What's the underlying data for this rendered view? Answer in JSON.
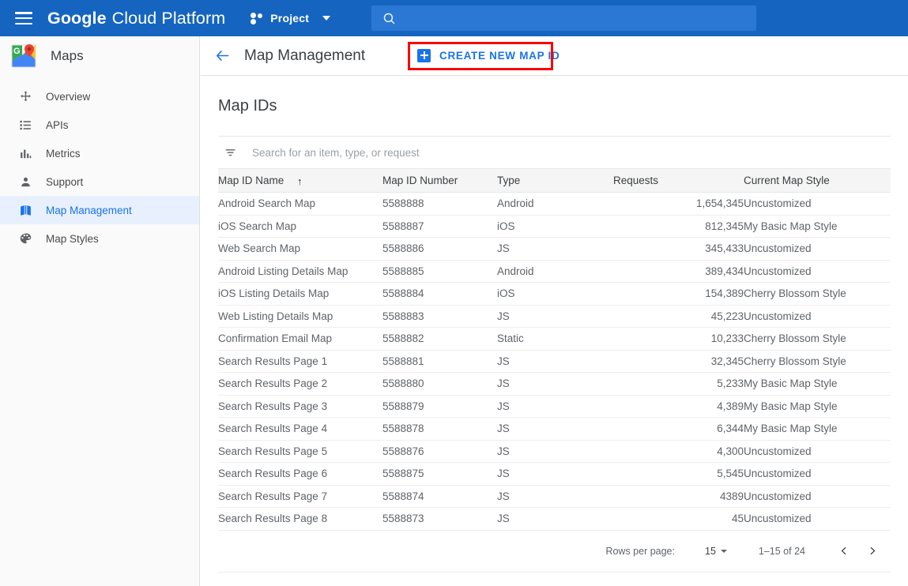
{
  "topbar": {
    "menu_icon": "hamburger-icon",
    "brand_bold": "Google",
    "brand_light": "Cloud Platform",
    "project_label": "Project",
    "project_icon": "project-dots-icon",
    "dropdown_icon": "chevron-down-icon",
    "search": {
      "value": "",
      "placeholder": "",
      "icon": "search-icon"
    },
    "bg_color": "#1565c0"
  },
  "sidebar": {
    "product_icon": "google-maps-logo-icon",
    "product_title": "Maps",
    "active_bg_color": "#e8f0fe",
    "active_text_color": "#1a73e8",
    "items": [
      {
        "label": "Overview",
        "icon": "overview-move-icon",
        "active": false
      },
      {
        "label": "APIs",
        "icon": "list-icon",
        "active": false
      },
      {
        "label": "Metrics",
        "icon": "bar-chart-icon",
        "active": false
      },
      {
        "label": "Support",
        "icon": "person-icon",
        "active": false
      },
      {
        "label": "Map Management",
        "icon": "map-icon",
        "active": true
      },
      {
        "label": "Map Styles",
        "icon": "palette-icon",
        "active": false
      }
    ]
  },
  "content": {
    "back_icon": "back-arrow-icon",
    "page_title": "Map Management",
    "create_button": {
      "label": "CREATE NEW MAP ID",
      "icon": "plus-square-icon",
      "color": "#1a73e8",
      "highlight_color": "#fb0007"
    },
    "section_title": "Map IDs",
    "filter": {
      "icon": "filter-icon",
      "value": "",
      "placeholder": "Search for an item, type, or request"
    },
    "table": {
      "columns": [
        {
          "label": "Map ID Name",
          "sort": "ascending",
          "sort_icon": "arrow-up-icon"
        },
        {
          "label": "Map ID Number"
        },
        {
          "label": "Type"
        },
        {
          "label": "Requests"
        },
        {
          "label": "Current Map Style"
        }
      ],
      "rows": [
        {
          "name": "Android Search Map",
          "number": "5588888",
          "type": "Android",
          "requests": "1,654,345",
          "style": "Uncustomized"
        },
        {
          "name": "iOS Search Map",
          "number": "5588887",
          "type": "iOS",
          "requests": "812,345",
          "style": "My Basic Map Style"
        },
        {
          "name": "Web Search Map",
          "number": "5588886",
          "type": "JS",
          "requests": "345,433",
          "style": "Uncustomized"
        },
        {
          "name": "Android Listing Details Map",
          "number": "5588885",
          "type": "Android",
          "requests": "389,434",
          "style": "Uncustomized"
        },
        {
          "name": "iOS Listing Details Map",
          "number": "5588884",
          "type": "iOS",
          "requests": "154,389",
          "style": "Cherry Blossom Style"
        },
        {
          "name": "Web Listing Details Map",
          "number": "5588883",
          "type": "JS",
          "requests": "45,223",
          "style": "Uncustomized"
        },
        {
          "name": "Confirmation Email Map",
          "number": "5588882",
          "type": "Static",
          "requests": "10,233",
          "style": "Cherry Blossom Style"
        },
        {
          "name": "Search Results Page 1",
          "number": "5588881",
          "type": "JS",
          "requests": "32,345",
          "style": "Cherry Blossom Style"
        },
        {
          "name": "Search Results Page 2",
          "number": "5588880",
          "type": "JS",
          "requests": "5,233",
          "style": "My Basic Map Style"
        },
        {
          "name": "Search Results Page 3",
          "number": "5588879",
          "type": "JS",
          "requests": "4,389",
          "style": "My Basic Map Style"
        },
        {
          "name": "Search Results Page 4",
          "number": "5588878",
          "type": "JS",
          "requests": "6,344",
          "style": "My Basic Map Style"
        },
        {
          "name": "Search Results Page 5",
          "number": "5588876",
          "type": "JS",
          "requests": "4,300",
          "style": "Uncustomized"
        },
        {
          "name": "Search Results Page 6",
          "number": "5588875",
          "type": "JS",
          "requests": "5,545",
          "style": "Uncustomized"
        },
        {
          "name": "Search Results Page 7",
          "number": "5588874",
          "type": "JS",
          "requests": "4389",
          "style": "Uncustomized"
        },
        {
          "name": "Search Results Page 8",
          "number": "5588873",
          "type": "JS",
          "requests": "45",
          "style": "Uncustomized"
        }
      ]
    },
    "pagination": {
      "rows_per_page_label": "Rows per page:",
      "rows_per_page_value": "15",
      "range_label": "1–15 of 24",
      "prev_icon": "chevron-left-icon",
      "next_icon": "chevron-right-icon"
    }
  }
}
